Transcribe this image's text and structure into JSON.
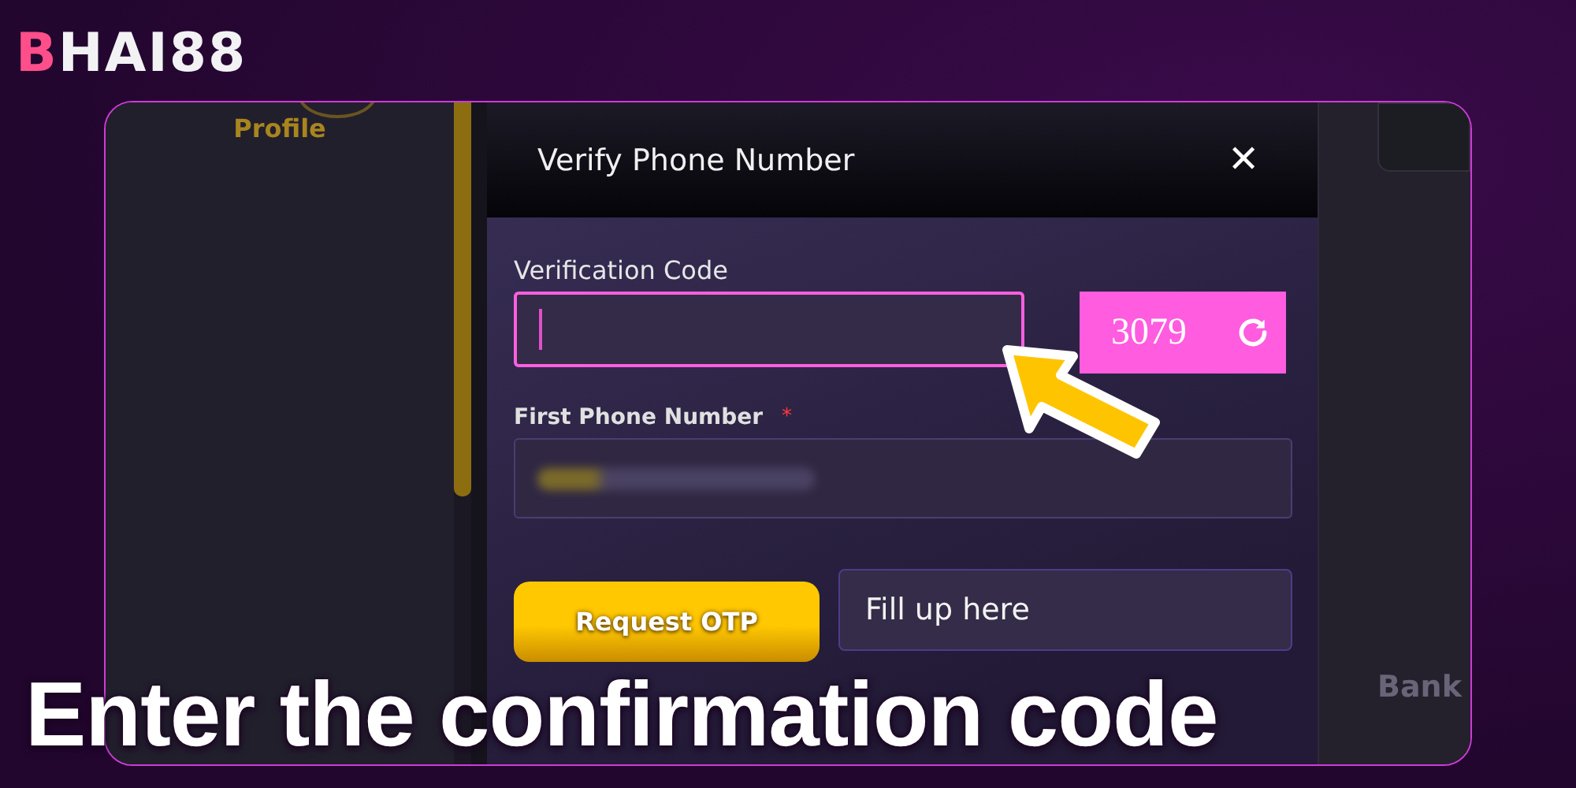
{
  "logo": "BHAI88",
  "sidebar": {
    "active_item": "Profile"
  },
  "modal": {
    "title": "Verify Phone Number",
    "close": "✕",
    "verification": {
      "label": "Verification Code",
      "captcha": "3079"
    },
    "phone": {
      "label": "First Phone Number",
      "required_mark": "*"
    },
    "request_button": "Request OTP",
    "otp": {
      "placeholder": "Fill up here"
    }
  },
  "right_panel": {
    "item": "Bank"
  },
  "caption": "Enter the confirmation code"
}
